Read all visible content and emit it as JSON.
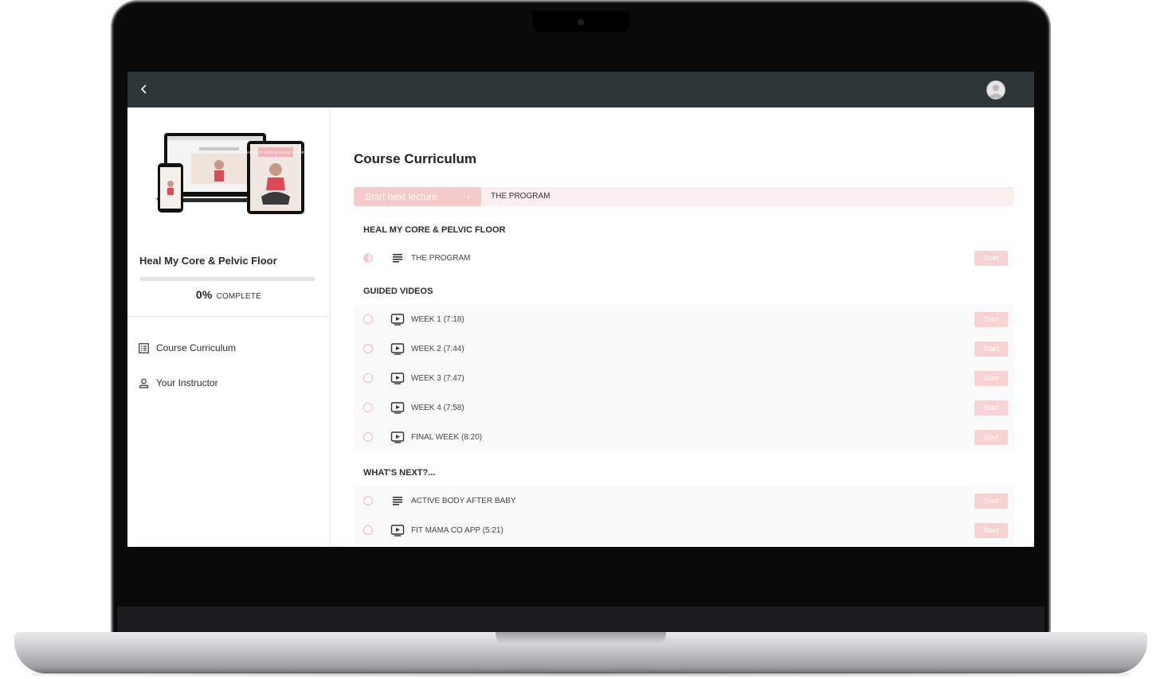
{
  "sidebar": {
    "course_title": "Heal My Core & Pelvic Floor",
    "progress_value": 0,
    "progress_percent": "0%",
    "progress_suffix": "COMPLETE",
    "thumb_title": "HEAL MY CORE & PELVIC FLOOR",
    "nav": [
      {
        "label": "Course Curriculum",
        "icon": "curriculum-icon"
      },
      {
        "label": "Your Instructor",
        "icon": "instructor-icon"
      }
    ]
  },
  "main": {
    "heading": "Course Curriculum",
    "start_next": {
      "label": "Start next lecture",
      "chevron": "›",
      "lecture": "THE PROGRAM"
    },
    "sections": [
      {
        "title": "HEAL MY CORE & PELVIC FLOOR",
        "lectures": [
          {
            "name": "THE PROGRAM",
            "type": "text",
            "status": "in-progress",
            "action": "Start"
          }
        ]
      },
      {
        "title": "GUIDED VIDEOS",
        "lectures": [
          {
            "name": "WEEK 1 (7:18)",
            "type": "video",
            "status": "not-started",
            "action": "Start"
          },
          {
            "name": "WEEK 2 (7:44)",
            "type": "video",
            "status": "not-started",
            "action": "Start"
          },
          {
            "name": "WEEK 3 (7:47)",
            "type": "video",
            "status": "not-started",
            "action": "Start"
          },
          {
            "name": "WEEK 4 (7:58)",
            "type": "video",
            "status": "not-started",
            "action": "Start"
          },
          {
            "name": "FINAL WEEK (8:20)",
            "type": "video",
            "status": "not-started",
            "action": "Start"
          }
        ]
      },
      {
        "title": "WHAT'S NEXT?...",
        "lectures": [
          {
            "name": "ACTIVE BODY AFTER BABY",
            "type": "text",
            "status": "not-started",
            "action": "Start"
          },
          {
            "name": "FIT MAMA CO APP (5:21)",
            "type": "video",
            "status": "not-started",
            "action": "Start"
          }
        ]
      }
    ]
  },
  "colors": {
    "topbar": "#2e3637",
    "accent": "#f4caca",
    "accent_light": "#fbeeee"
  }
}
